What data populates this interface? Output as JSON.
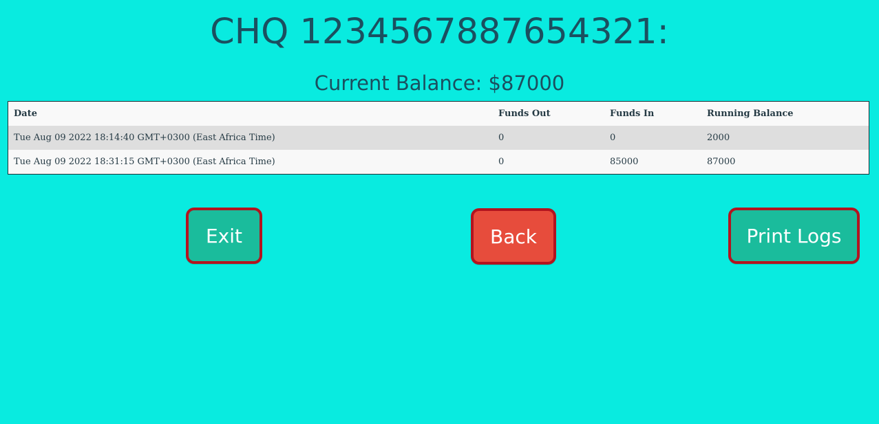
{
  "header": {
    "title": "CHQ 1234567887654321:",
    "balance": "Current Balance: $87000"
  },
  "table": {
    "columns": [
      "Date",
      "Funds Out",
      "Funds In",
      "Running Balance"
    ],
    "rows": [
      {
        "date": "Tue Aug 09 2022 18:14:40 GMT+0300 (East Africa Time)",
        "funds_out": "0",
        "funds_in": "0",
        "running_balance": "2000"
      },
      {
        "date": "Tue Aug 09 2022 18:31:15 GMT+0300 (East Africa Time)",
        "funds_out": "0",
        "funds_in": "85000",
        "running_balance": "87000"
      }
    ]
  },
  "buttons": {
    "exit": "Exit",
    "back": "Back",
    "print_logs": "Print Logs"
  },
  "colors": {
    "background": "#09ebe0",
    "text": "#1b4f5f",
    "button_green": "#1abc9c",
    "button_red": "#e74c3c",
    "button_border": "#b3141f"
  }
}
